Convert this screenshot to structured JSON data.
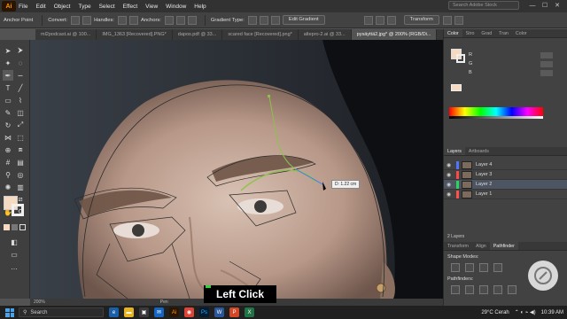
{
  "app": {
    "logo": "Ai"
  },
  "menu": [
    "File",
    "Edit",
    "Object",
    "Type",
    "Select",
    "Effect",
    "View",
    "Window",
    "Help"
  ],
  "search_stock_placeholder": "Search Adobe Stock",
  "window_controls": {
    "minimize": "—",
    "maximize": "☐",
    "close": "✕"
  },
  "control_bar": {
    "tool": "Anchor Point",
    "convert": "Convert:",
    "handles": "Handles:",
    "anchors": "Anchors:",
    "gradient_type": "Gradient Type:",
    "edit_gradient": "Edit Gradient",
    "transform": "Transform"
  },
  "tabs": [
    "ml2podcast.ai @ 100...",
    "IMG_1363 [Recovered].PNG*",
    "dapos.pdf @ 33...",
    "scared face [Recovered].png*",
    "altepro-2.ai @ 33...",
    "pysäyttä2.jpg* @ 200% (RGB/Di..."
  ],
  "canvas": {
    "tooltip": "D: 1.22 cm"
  },
  "status": {
    "zoom": "200%",
    "tool": "Pen"
  },
  "color_panel": {
    "tabs": [
      "Color",
      "Stro",
      "Grad",
      "Tran",
      "Color"
    ],
    "rows": [
      "R",
      "G",
      "B"
    ]
  },
  "layers_panel": {
    "tabs": [
      "Layers",
      "Artboards"
    ],
    "layers": [
      {
        "name": "Layer 4",
        "color": "#4f74ff"
      },
      {
        "name": "Layer 3",
        "color": "#ff4848"
      },
      {
        "name": "Layer 2",
        "color": "#2bd45a"
      },
      {
        "name": "Layer 1",
        "color": "#ff4f4f"
      }
    ],
    "count_label": "2 Layers"
  },
  "pathfinder_panel": {
    "tabs": [
      "Transform",
      "Align",
      "Pathfinder"
    ],
    "shape_modes": "Shape Modes:",
    "pathfinders": "Pathfinders:"
  },
  "caption": "Left Click",
  "taskbar": {
    "search": "Search",
    "weather": "29°C Cerah",
    "time": "10:39 AM",
    "icons": [
      "edge-icon",
      "folder-icon",
      "store-icon",
      "mail-icon",
      "illustrator-icon",
      "chrome-icon",
      "photoshop-icon",
      "word-icon",
      "powerpoint-icon",
      "excel-icon"
    ]
  },
  "colors": {
    "accent": "#ff9a00",
    "selection": "#4d5563"
  }
}
